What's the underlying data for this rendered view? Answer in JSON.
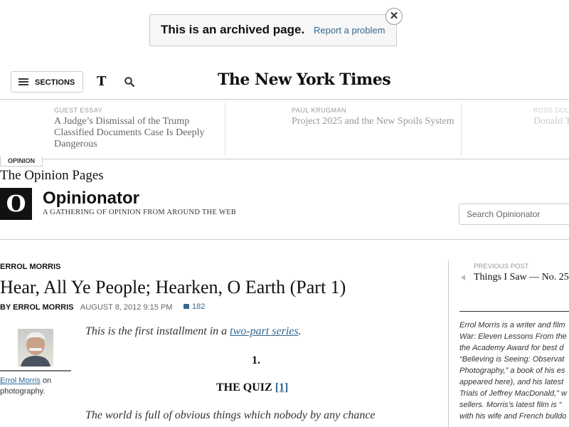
{
  "archive_banner": {
    "title": "This is an archived page.",
    "report_link": "Report a problem",
    "close_glyph": "✕"
  },
  "masthead": {
    "sections_label": "SECTIONS",
    "t_icon": "T",
    "logo": "The New York Times"
  },
  "ribbon": {
    "items": [
      {
        "kicker": "GUEST ESSAY",
        "headline_lines": [
          "A Judge’s Dismissal of the Trump",
          "Classified Documents Case Is Deeply",
          "Dangerous"
        ]
      },
      {
        "kicker": "PAUL KRUGMAN",
        "headline_lines": [
          "Project 2025 and the New Spoils System"
        ]
      },
      {
        "kicker": "ROSS DOUT",
        "headline_lines": [
          "Donald T"
        ]
      }
    ]
  },
  "opinion_tab": "OPINION",
  "opinion_pages": "The Opinion Pages",
  "blog": {
    "logo_letter": "O",
    "title": "Opinionator",
    "subtitle": "A GATHERING OF OPINION FROM AROUND THE WEB",
    "search_placeholder": "Search Opinionator"
  },
  "article": {
    "author_kicker": "ERROL MORRIS",
    "headline": "Hear, All Ye People; Hearken, O Earth (Part 1)",
    "byline": "BY ERROL MORRIS",
    "date": "AUGUST 8, 2012 9:15 PM",
    "comments": "182",
    "author_name": "Errol Morris",
    "author_note_tail": " on photography.",
    "intro_before": "This is the first installment in a ",
    "intro_link": "two-part series",
    "intro_after": ".",
    "section_number": "1.",
    "quiz_label": "THE QUIZ ",
    "quiz_footnote": "[1]",
    "body_line": "The world is full of obvious things which nobody by any chance"
  },
  "sidebar": {
    "prev_label": "PREVIOUS POST",
    "prev_title": "Things I Saw — No. 25",
    "bio_lines": [
      "Errol Morris is a writer and film",
      "War: Eleven Lessons From the",
      "the Academy Award for best d",
      "“Believing is Seeing: Observat",
      "Photography,” a book of his es",
      "appeared here), and his latest",
      "Trials of Jeffrey MacDonald,” w",
      "sellers. Morris’s latest film is “",
      "with his wife and French bulldo"
    ]
  }
}
